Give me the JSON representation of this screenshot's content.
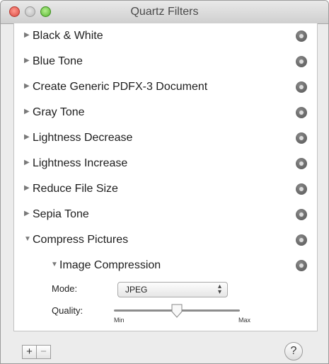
{
  "window": {
    "title": "Quartz Filters"
  },
  "filters": [
    {
      "label": "Black & White",
      "expanded": false
    },
    {
      "label": "Blue Tone",
      "expanded": false
    },
    {
      "label": "Create Generic PDFX-3 Document",
      "expanded": false
    },
    {
      "label": "Gray Tone",
      "expanded": false
    },
    {
      "label": "Lightness Decrease",
      "expanded": false
    },
    {
      "label": "Lightness Increase",
      "expanded": false
    },
    {
      "label": "Reduce File Size",
      "expanded": false
    },
    {
      "label": "Sepia Tone",
      "expanded": false
    },
    {
      "label": "Compress Pictures",
      "expanded": true
    }
  ],
  "subfilter": {
    "label": "Image Compression",
    "expanded": true,
    "mode_label": "Mode:",
    "mode_value": "JPEG",
    "quality_label": "Quality:",
    "quality_min": "Min",
    "quality_max": "Max",
    "quality_level": 0.5
  },
  "toolbar": {
    "add": "+",
    "remove": "−",
    "help": "?"
  },
  "icons": {
    "collapsed": "triangle-right-icon",
    "expanded": "triangle-down-icon",
    "options": "gear-icon"
  },
  "colors": {
    "close": "#d9473f",
    "minimize": "#b9b9b9",
    "zoom": "#55b52d"
  }
}
